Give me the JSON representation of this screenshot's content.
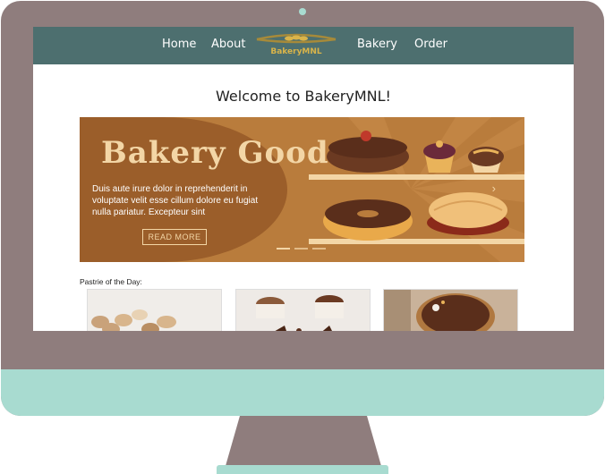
{
  "nav": {
    "home": "Home",
    "about": "About",
    "bakery": "Bakery",
    "order": "Order",
    "logo_text": "BakeryMNL"
  },
  "page": {
    "title": "Welcome to BakeryMNL!"
  },
  "carousel": {
    "slide_title": "Bakery Goods",
    "slide_text": "Duis aute irure dolor in reprehenderit in voluptate velit esse cillum dolore eu fugiat nulla pariatur. Excepteur sint",
    "cta_label": "READ MORE",
    "active_slide": 1,
    "slide_count": 3
  },
  "pastry_section": {
    "label": "Pastrie of the Day:",
    "cards": [
      {
        "name": "cupcakes"
      },
      {
        "name": "chocolate-cakes"
      },
      {
        "name": "chocolate-tart"
      }
    ]
  },
  "colors": {
    "navbar": "#4d6f6f",
    "monitor_frame": "#8f7d7d",
    "monitor_chin": "#a8dbd0",
    "accent_gold": "#d9b44a",
    "carousel_brown": "#b97c3c"
  }
}
